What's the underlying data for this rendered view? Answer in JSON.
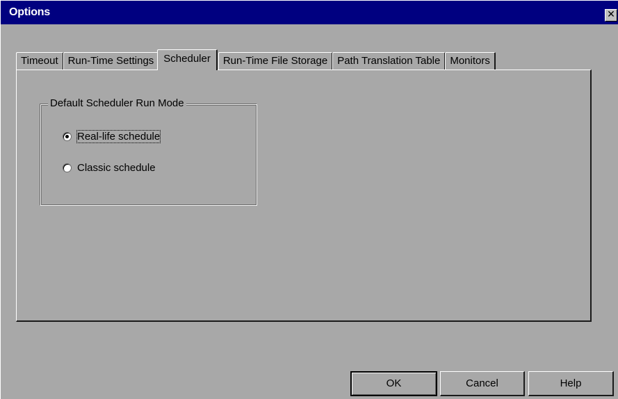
{
  "window": {
    "title": "Options",
    "close_glyph": "✕"
  },
  "tabs": [
    {
      "label": "Timeout",
      "active": false
    },
    {
      "label": "Run-Time Settings",
      "active": false
    },
    {
      "label": "Scheduler",
      "active": true
    },
    {
      "label": "Run-Time File Storage",
      "active": false
    },
    {
      "label": "Path Translation Table",
      "active": false
    },
    {
      "label": "Monitors",
      "active": false
    }
  ],
  "scheduler": {
    "group_title": "Default Scheduler Run Mode",
    "options": [
      {
        "label": "Real-life schedule",
        "checked": true
      },
      {
        "label": "Classic schedule",
        "checked": false
      }
    ]
  },
  "buttons": {
    "ok": "OK",
    "cancel": "Cancel",
    "help": "Help"
  },
  "colors": {
    "titlebar": "#000080",
    "face": "#a8a8a8"
  }
}
